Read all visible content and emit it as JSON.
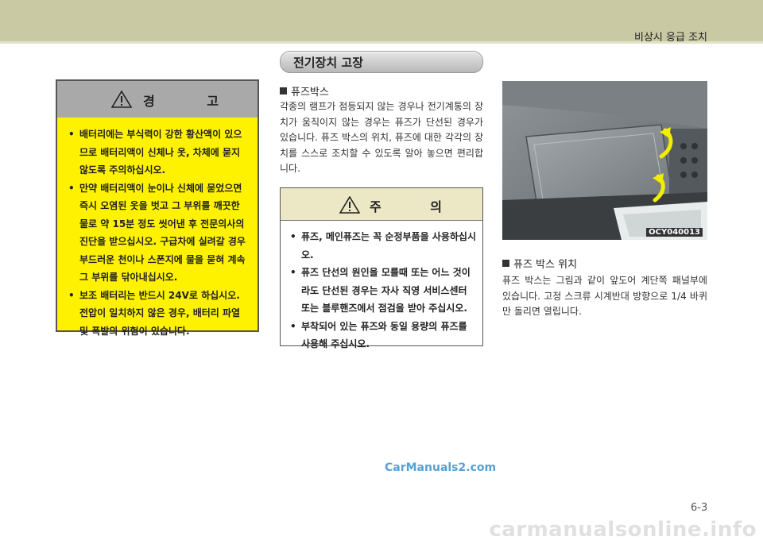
{
  "header": {
    "chapter_title": "비상시 응급 조치"
  },
  "section_title": "전기장치 고장",
  "warning_box": {
    "title": "경 고",
    "items": [
      "배터리에는 부식력이 강한 황산액이 있으므로 배터리액이 신체나 옷, 차체에 묻지 않도록 주의하십시오.",
      "만약 배터리액이 눈이나 신체에 묻었으면 즉시 오염된 옷을 벗고 그 부위를 깨끗한 물로 약 15분 정도 씻어낸 후 전문의사의 진단을 받으십시오. 구급차에 실려갈 경우 부드러운 천이나 스폰지에 물을 묻혀 계속 그 부위를 닦아내십시오.",
      "보조 배터리는 반드시 24V로 하십시오. 전압이 일치하지 않은 경우, 배터리 파열 및 폭발의 위험이 있습니다."
    ]
  },
  "fuse_box_section": {
    "heading": "퓨즈박스",
    "paragraph": "각종의 램프가 점등되지 않는 경우나 전기계통의 장치가 움직이지 않는 경우는 퓨즈가 단선된 경우가 있습니다. 퓨즈 박스의 위치, 퓨즈에 대한 각각의 장치를 스스로 조치할 수 있도록 알아 놓으면 편리합니다."
  },
  "caution_box": {
    "title": "주 의",
    "items": [
      "퓨즈, 메인퓨즈는 꼭 순정부품을 사용하십시오.",
      "퓨즈 단선의 원인을 모를때 또는 어느 것이라도 단선된 경우는 자사 직영 서비스센터 또는 블루핸즈에서 점검을 받아 주십시오.",
      "부착되어 있는 퓨즈와 동일 용량의 퓨즈를 사용해 주십시오."
    ]
  },
  "photo": {
    "code": "OCY040013"
  },
  "fuse_location_section": {
    "heading": "퓨즈 박스 위치",
    "paragraph": "퓨즈 박스는 그림과 같이 앞도어 계단쪽 패널부에 있습니다. 고정 스크류 시계반대 방향으로 1/4 바퀴만 돌리면 열립니다."
  },
  "watermark": "CarManuals2.com",
  "page_number": "6-3",
  "footer_watermark": "carmanualsonline.info",
  "colors": {
    "warning_bg": "#fff200",
    "header_band": "#c9c9a3",
    "caution_head": "#ece8c6"
  }
}
